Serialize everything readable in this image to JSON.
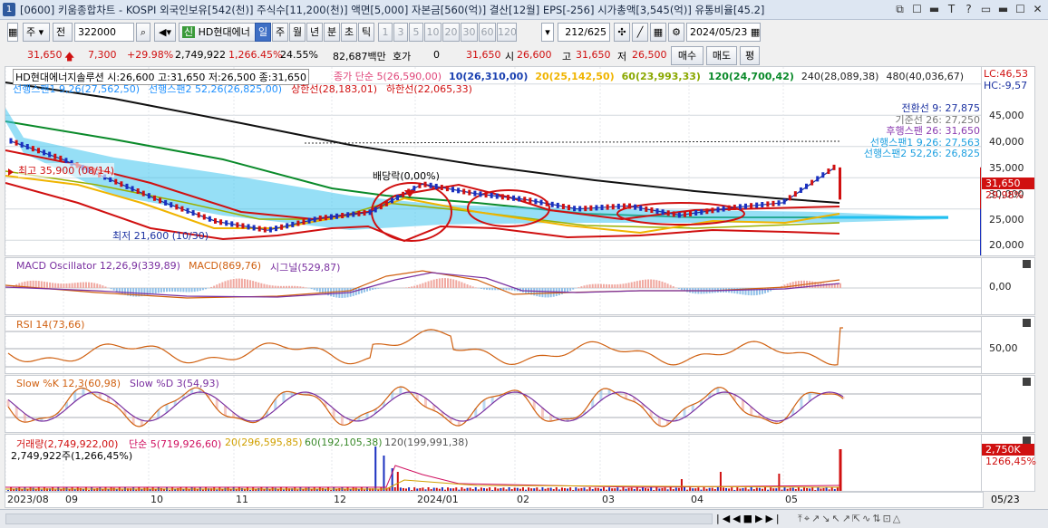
{
  "window": {
    "badge": "1",
    "title": "[0600] 키움종합차트 - KOSPI 외국인보유[542(천)] 주식수[11,200(천)] 액면[5,000] 자본금[560(억)] 결산[12월] EPS[-256] 시가총액[3,545(억)] 유통비율[45.2]",
    "controls": [
      "⧉",
      "☐",
      "▬",
      "T",
      "?",
      "▭",
      "▬",
      "☐",
      "✕"
    ]
  },
  "toolbar": {
    "market": "주",
    "jeon": "전",
    "code": "322000",
    "stock_tag": "신",
    "stock_name": "HD현대에너",
    "periods": [
      "일",
      "주",
      "월",
      "년",
      "분",
      "초",
      "틱"
    ],
    "intervals": [
      "1",
      "3",
      "5",
      "10",
      "20",
      "30",
      "60",
      "120"
    ],
    "count": "212",
    "total": "/625",
    "date": "2024/05/23",
    "buy": "매수",
    "sell": "매도",
    "avg": "평"
  },
  "quote": {
    "price": "31,650",
    "change": "7,300",
    "change_pct": "+29.98%",
    "volume": "2,749,922",
    "vol_pct": "1,266.45%",
    "turnover": "24.55%",
    "amount": "82,687백만",
    "hoga_label": "호가",
    "hoga": "0",
    "last": "31,650",
    "open_label": "시",
    "open": "26,600",
    "high_label": "고",
    "high": "31,650",
    "low_label": "저",
    "low": "26,500"
  },
  "price_pane": {
    "line1_name": "HD현대에너지솔루션 시:26,600 고:31,650 저:26,500 종:31,650",
    "ma_line": [
      {
        "text": "종가 단순 5(26,590,00)",
        "color": "#e0467a"
      },
      {
        "text": "10(26,310,00)",
        "color": "#1a40b0"
      },
      {
        "text": "20(25,142,50)",
        "color": "#f0b400"
      },
      {
        "text": "60(23,993,33)",
        "color": "#8aa800"
      },
      {
        "text": "120(24,700,42)",
        "color": "#0a8a2a"
      },
      {
        "text": "240(28,089,38)",
        "color": "#222222"
      },
      {
        "text": "480(40,036,67)",
        "color": "#222222"
      }
    ],
    "ichimoku_line": [
      {
        "text": "선행스팬1 9,26(27,562,50)",
        "color": "#1e90ff"
      },
      {
        "text": "선행스팬2 52,26(26,825,00)",
        "color": "#1e90ff"
      },
      {
        "text": "상한선(28,183,01)",
        "color": "#d01010"
      },
      {
        "text": "하한선(22,065,33)",
        "color": "#d01010"
      }
    ],
    "right_legend": [
      {
        "text": "전환선 9: 27,875",
        "color": "#1a30a0"
      },
      {
        "text": "기준선 26: 27,250",
        "color": "#777777"
      },
      {
        "text": "후행스팬 26: 31,650",
        "color": "#8a3ab0"
      },
      {
        "text": "선행스팬1 9,26: 27,563",
        "color": "#1ea0e0"
      },
      {
        "text": "선행스팬2 52,26: 26,825",
        "color": "#1ea0e0"
      }
    ],
    "annotations": {
      "high": "최고 35,900 (08/14)",
      "low": "최저 21,600 (10/30)",
      "dividend": "배당락(0,00%)"
    },
    "lc": "LC:46,53",
    "hc": "HC:-9,57",
    "price_tag": "31,650",
    "pct_tag": "29,98%",
    "y_ticks": [
      "45,000",
      "40,000",
      "35,000",
      "30,000",
      "25,000",
      "20,000"
    ]
  },
  "macd_pane": {
    "osc": "MACD Oscillator 12,26,9(339,89)",
    "macd": "MACD(869,76)",
    "signal": "시그널(529,87)",
    "zero": "0,00"
  },
  "rsi_pane": {
    "label": "RSI 14(73,66)",
    "mid": "50,00"
  },
  "stoch_pane": {
    "k": "Slow %K 12,3(60,98)",
    "d": "Slow %D 3(54,93)"
  },
  "volume_pane": {
    "label": "거래량(2,749,922,00)",
    "ma5": "단순 5(719,926,60)",
    "ma20": "20(296,595,85)",
    "ma60": "60(192,105,38)",
    "ma120": "120(199,991,38)",
    "detail": "2,749,922주(1,266,45%)",
    "tag": "2,750K",
    "pct": "1266,45%"
  },
  "x_axis": {
    "labels": [
      "2023/08",
      "09",
      "10",
      "11",
      "12",
      "2024/01",
      "02",
      "03",
      "04",
      "05"
    ],
    "right": "05/23"
  },
  "chart_data": {
    "type": "line",
    "series": [
      {
        "name": "종가",
        "values": [
          35900,
          33000,
          29500,
          26000,
          23000,
          21600,
          23500,
          24500,
          29000,
          27500,
          26500,
          25000,
          25500,
          24000,
          25200,
          26000,
          31650
        ]
      }
    ],
    "x": [
      "2023/08",
      "2023/08",
      "2023/09",
      "2023/09",
      "2023/10",
      "2023/10",
      "2023/11",
      "2023/11",
      "2023/12",
      "2023/12",
      "2024/01",
      "2024/02",
      "2024/03",
      "2024/03",
      "2024/04",
      "2024/05",
      "2024/05"
    ],
    "ylim": [
      18000,
      47000
    ]
  }
}
